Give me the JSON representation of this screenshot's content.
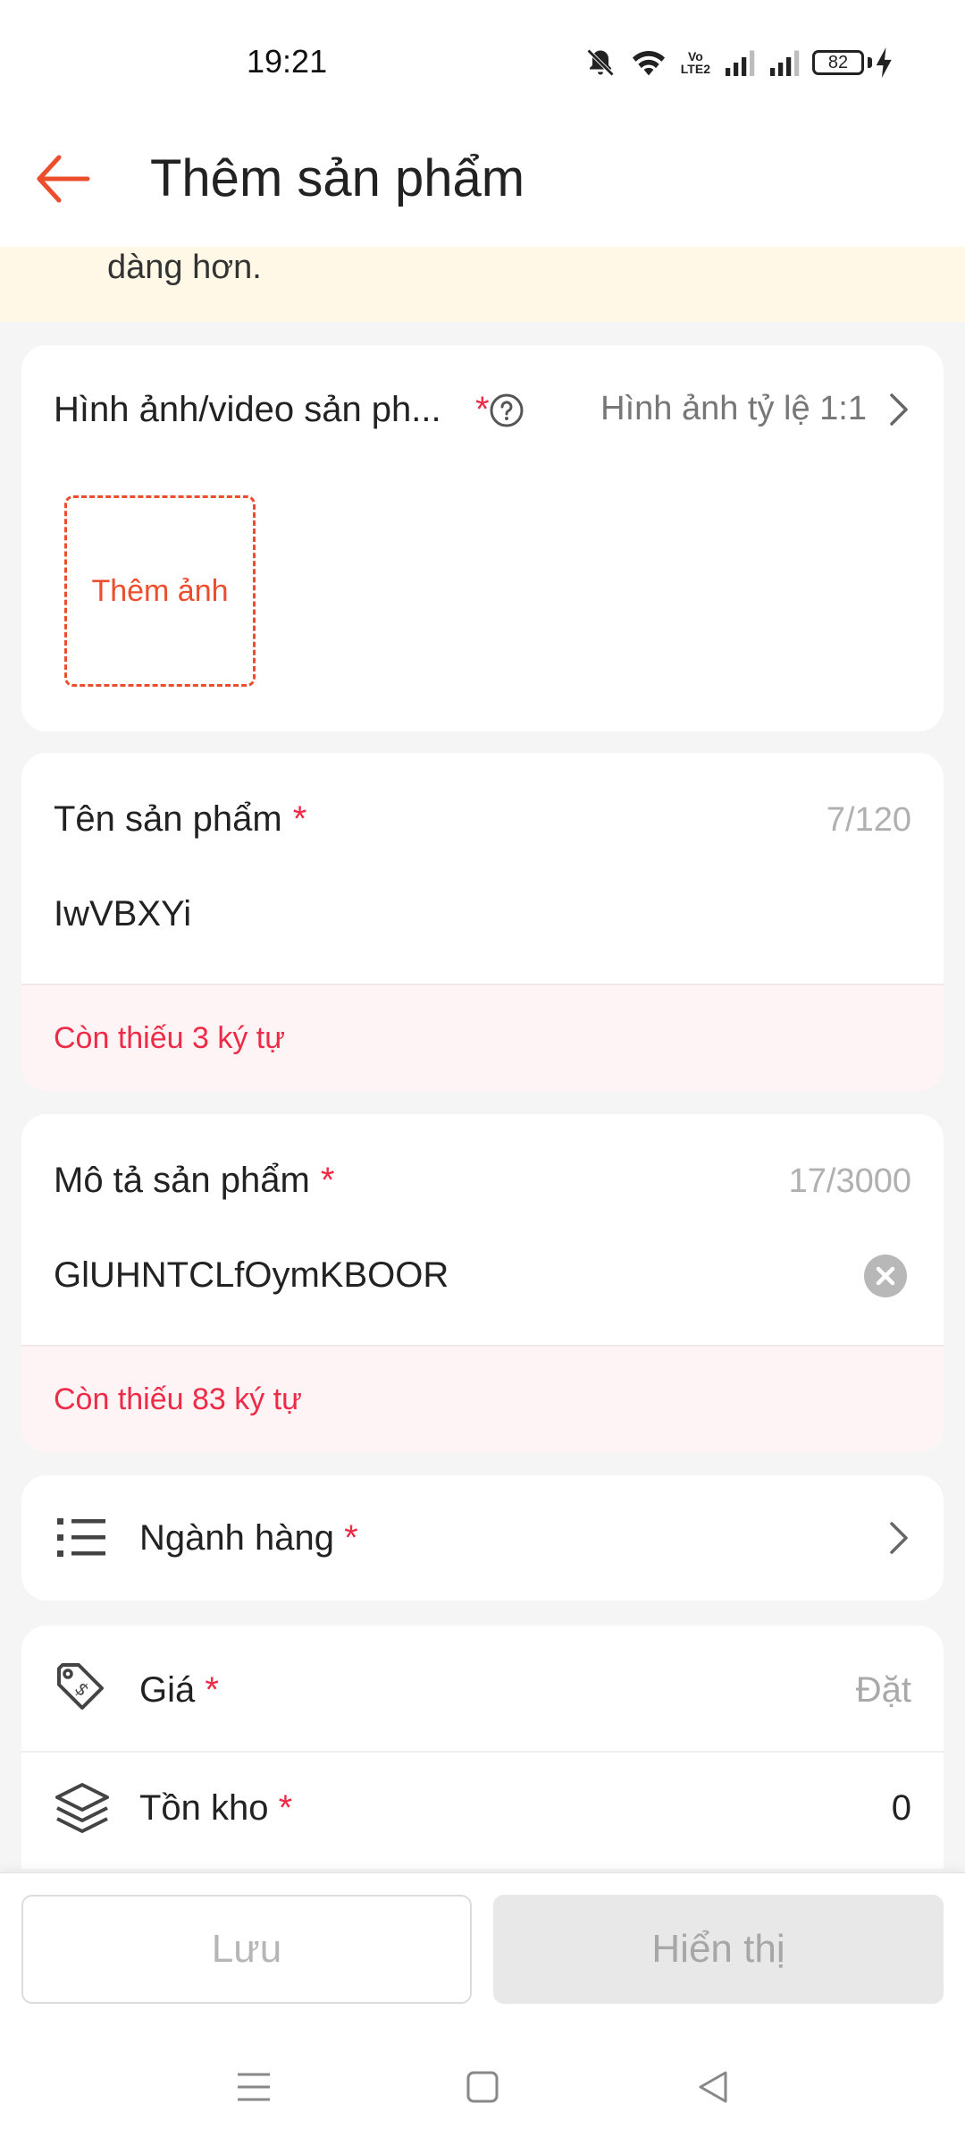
{
  "status_bar": {
    "time": "19:21",
    "battery": "82",
    "volte": "LTE2"
  },
  "header": {
    "title": "Thêm sản phẩm"
  },
  "notice": {
    "text": "dàng hơn."
  },
  "media": {
    "label": "Hình ảnh/video sản ph...",
    "required_mark": "*",
    "ratio_text": "Hình ảnh tỷ lệ 1:1",
    "add_photo_label": "Thêm ảnh"
  },
  "product_name": {
    "label": "Tên sản phẩm",
    "required_mark": "*",
    "counter": "7/120",
    "value": "IwVBXYi",
    "error": "Còn thiếu 3 ký tự"
  },
  "product_description": {
    "label": "Mô tả sản phẩm",
    "required_mark": "*",
    "counter": "17/3000",
    "value": "GlUHNTCLfOymKBOOR",
    "error": "Còn thiếu 83 ký tự"
  },
  "category": {
    "label": "Ngành hàng",
    "required_mark": "*"
  },
  "price": {
    "label": "Giá",
    "required_mark": "*",
    "placeholder": "Đặt"
  },
  "stock": {
    "label": "Tồn kho",
    "required_mark": "*",
    "value": "0"
  },
  "actions": {
    "save_label": "Lưu",
    "show_label": "Hiển thị"
  },
  "colors": {
    "accent": "#ee4d2d",
    "required": "#ee2b47",
    "notice_bg": "#fff8e7",
    "error_bg": "#fff4f5"
  },
  "icons": {
    "back": "arrow-left-icon",
    "help": "question-circle-icon",
    "chevron": "chevron-right-icon",
    "clear": "clear-circle-icon",
    "category": "list-icon",
    "price": "price-tag-icon",
    "stock": "layers-icon"
  }
}
